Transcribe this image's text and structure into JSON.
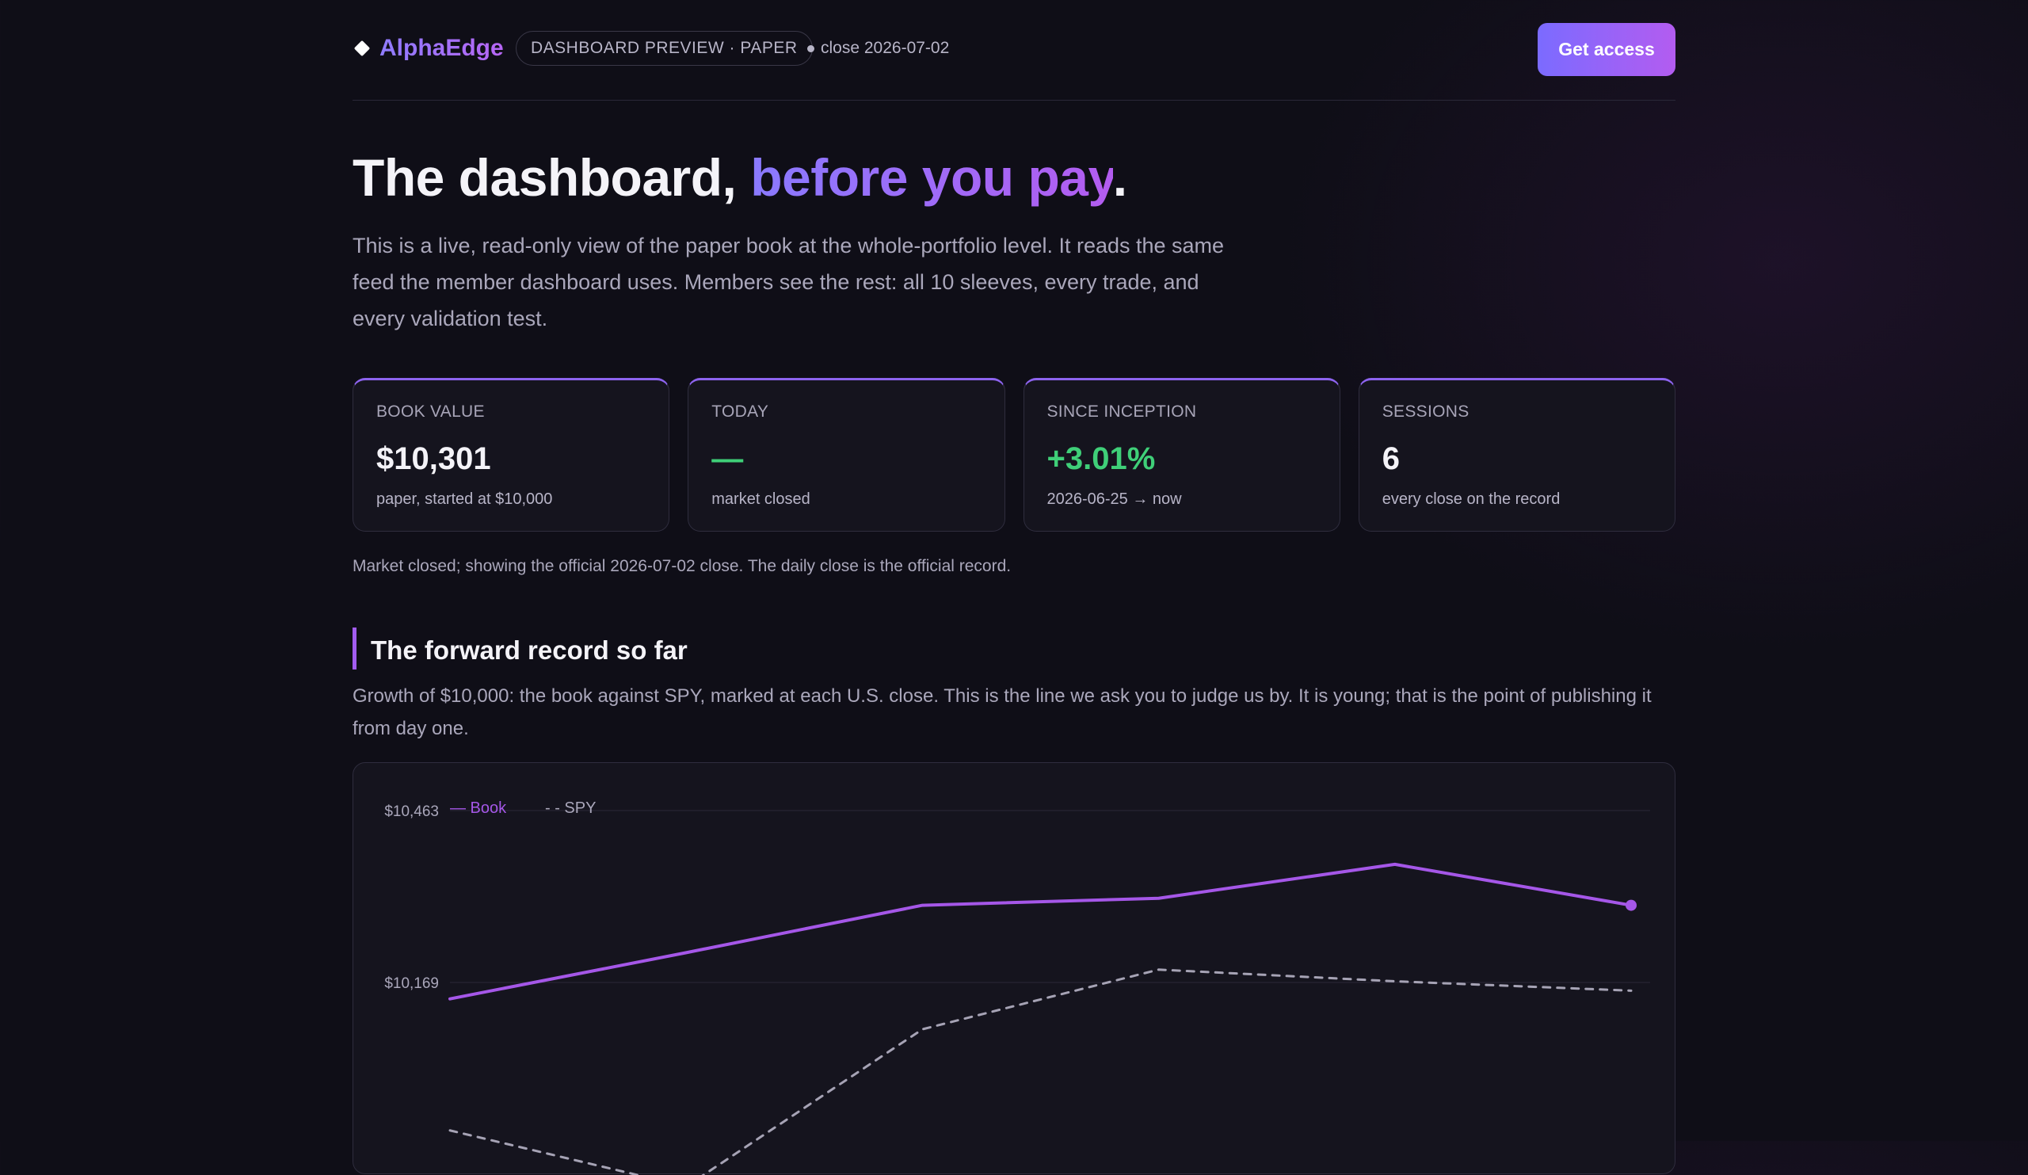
{
  "header": {
    "brand": "AlphaEdge",
    "badge": "DASHBOARD PREVIEW · PAPER",
    "close_label": "close 2026-07-02",
    "cta_label": "Get access"
  },
  "hero": {
    "title_lead": "The dashboard, ",
    "title_accent": "before you pay",
    "title_end": ".",
    "description": "This is a live, read-only view of the paper book at the whole-portfolio level. It reads the same feed the member dashboard uses. Members see the rest: all 10 sleeves, every trade, and every validation test."
  },
  "stats": [
    {
      "label": "BOOK VALUE",
      "value": "$10,301",
      "sub": "paper, started at $10,000"
    },
    {
      "label": "TODAY",
      "value": "—",
      "sub": "market closed"
    },
    {
      "label": "SINCE INCEPTION",
      "value": "+3.01%",
      "sub": "2026-06-25 → now"
    },
    {
      "label": "SESSIONS",
      "value": "6",
      "sub": "every close on the record"
    }
  ],
  "market_note": "Market closed; showing the official 2026-07-02 close. The daily close is the official record.",
  "section": {
    "title": "The forward record so far",
    "description": "Growth of $10,000: the book against SPY, marked at each U.S. close. This is the line we ask you to judge us by. It is young; that is the point of publishing it from day one."
  },
  "colors": {
    "accent_start": "#7b6bff",
    "accent_end": "#b35cf0",
    "book_line": "#a557e8",
    "spy_line": "#a6a3b5",
    "positive": "#3fcf78"
  },
  "chart_data": {
    "type": "line",
    "x": [
      1,
      2,
      3,
      4,
      5,
      6
    ],
    "series": [
      {
        "name": "Book",
        "values": [
          10141,
          10220,
          10301,
          10313,
          10371,
          10301
        ],
        "style": "solid"
      },
      {
        "name": "SPY",
        "values": [
          9916,
          9820,
          10089,
          10191,
          10171,
          10155
        ],
        "style": "dashed"
      }
    ],
    "y_ticks": [
      {
        "value": 10463,
        "label": "$10,463"
      },
      {
        "value": 10169,
        "label": "$10,169"
      }
    ],
    "legend_labels": [
      "— Book",
      "- - SPY"
    ],
    "legend_position": "top-left",
    "grid": true
  }
}
